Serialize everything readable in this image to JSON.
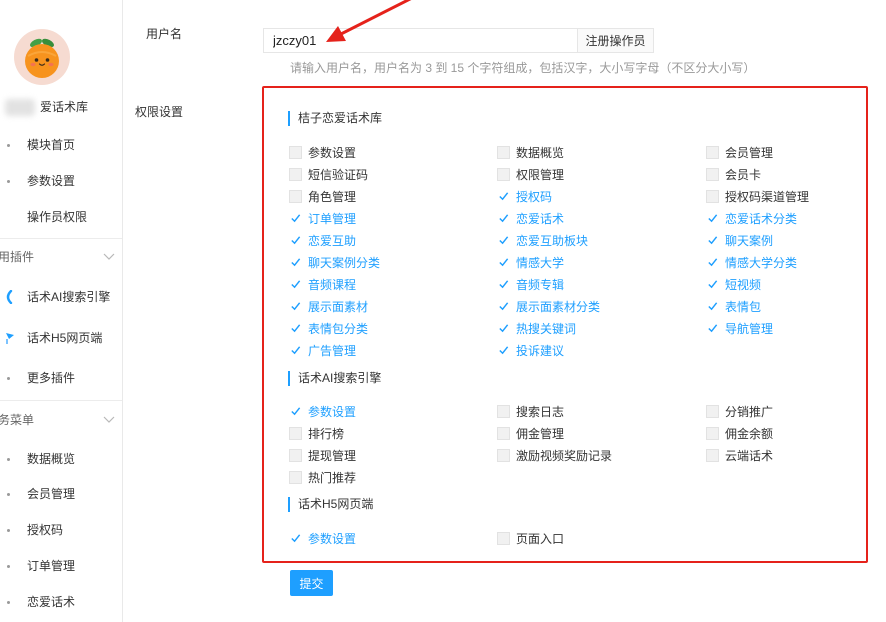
{
  "sidebar": {
    "brand_label": "爱话术库",
    "items": [
      {
        "label": "模块首页"
      },
      {
        "label": "参数设置"
      },
      {
        "label": "操作员权限"
      }
    ],
    "groups": [
      {
        "title": "用插件",
        "items": [
          {
            "label": "话术AI搜索引擎"
          },
          {
            "label": "话术H5网页端"
          },
          {
            "label": "更多插件"
          }
        ]
      },
      {
        "title": "务菜单",
        "items": [
          {
            "label": "数据概览"
          },
          {
            "label": "会员管理"
          },
          {
            "label": "授权码"
          },
          {
            "label": "订单管理"
          },
          {
            "label": "恋爱话术"
          }
        ]
      }
    ]
  },
  "form": {
    "username_label": "用户名",
    "username_value": "jzczy01",
    "register_button": "注册操作员",
    "username_hint": "请输入用户名，用户名为 3 到 15 个字符组成，包括汉字，大小写字母（不区分大小写）",
    "permissions_label": "权限设置",
    "submit_label": "提交"
  },
  "permission_sections": [
    {
      "title": "桔子恋爱话术库",
      "options": [
        {
          "label": "参数设置",
          "checked": false
        },
        {
          "label": "数据概览",
          "checked": false
        },
        {
          "label": "会员管理",
          "checked": false
        },
        {
          "label": "短信验证码",
          "checked": false
        },
        {
          "label": "权限管理",
          "checked": false
        },
        {
          "label": "会员卡",
          "checked": false
        },
        {
          "label": "角色管理",
          "checked": false
        },
        {
          "label": "授权码",
          "checked": true
        },
        {
          "label": "授权码渠道管理",
          "checked": false
        },
        {
          "label": "订单管理",
          "checked": true
        },
        {
          "label": "恋爱话术",
          "checked": true
        },
        {
          "label": "恋爱话术分类",
          "checked": true
        },
        {
          "label": "恋爱互助",
          "checked": true
        },
        {
          "label": "恋爱互助板块",
          "checked": true
        },
        {
          "label": "聊天案例",
          "checked": true
        },
        {
          "label": "聊天案例分类",
          "checked": true
        },
        {
          "label": "情感大学",
          "checked": true
        },
        {
          "label": "情感大学分类",
          "checked": true
        },
        {
          "label": "音频课程",
          "checked": true
        },
        {
          "label": "音频专辑",
          "checked": true
        },
        {
          "label": "短视频",
          "checked": true
        },
        {
          "label": "展示面素材",
          "checked": true
        },
        {
          "label": "展示面素材分类",
          "checked": true
        },
        {
          "label": "表情包",
          "checked": true
        },
        {
          "label": "表情包分类",
          "checked": true
        },
        {
          "label": "热搜关键词",
          "checked": true
        },
        {
          "label": "导航管理",
          "checked": true
        },
        {
          "label": "广告管理",
          "checked": true
        },
        {
          "label": "投诉建议",
          "checked": true
        }
      ]
    },
    {
      "title": "话术AI搜索引擎",
      "options": [
        {
          "label": "参数设置",
          "checked": true
        },
        {
          "label": "搜索日志",
          "checked": false
        },
        {
          "label": "分销推广",
          "checked": false
        },
        {
          "label": "排行榜",
          "checked": false
        },
        {
          "label": "佣金管理",
          "checked": false
        },
        {
          "label": "佣金余额",
          "checked": false
        },
        {
          "label": "提现管理",
          "checked": false
        },
        {
          "label": "激励视频奖励记录",
          "checked": false
        },
        {
          "label": "云端话术",
          "checked": false
        },
        {
          "label": "热门推荐",
          "checked": false
        }
      ]
    },
    {
      "title": "话术H5网页端",
      "options": [
        {
          "label": "参数设置",
          "checked": true
        },
        {
          "label": "页面入口",
          "checked": false
        }
      ]
    }
  ],
  "colors": {
    "accent": "#1e9fff",
    "annotation_red": "#e5221b"
  },
  "icons": {
    "logo": "orange-fruit-logo",
    "plugin_search": "search-engine-icon",
    "plugin_h5": "h5-page-icon",
    "group_toggle": "chevron-down-icon",
    "checked": "check-icon",
    "annotation": "red-arrow"
  }
}
